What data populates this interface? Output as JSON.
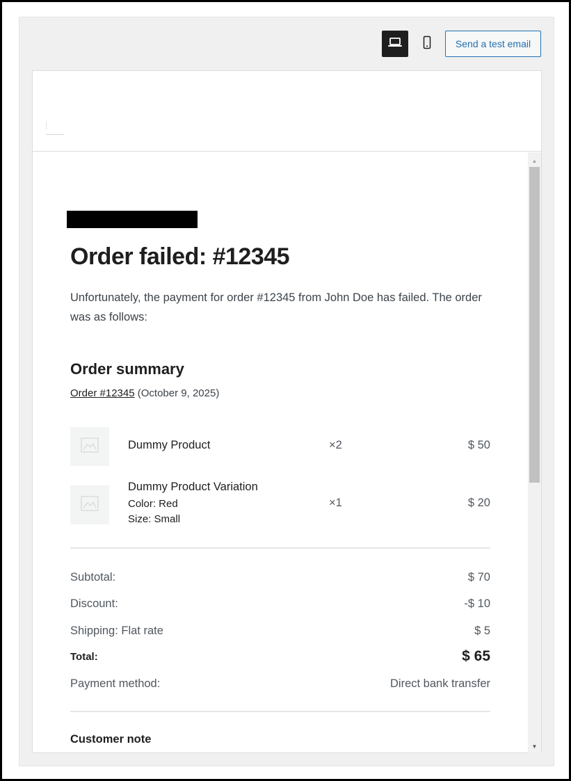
{
  "toolbar": {
    "desktop_icon": "laptop-icon",
    "mobile_icon": "smartphone-icon",
    "send_test_email_label": "Send a test email"
  },
  "email": {
    "title": "Order failed: #12345",
    "intro": "Unfortunately, the payment for order #12345 from John Doe has failed. The order was as follows:",
    "summary_heading": "Order summary",
    "order_link": "Order #12345",
    "order_date": "(October 9, 2025)",
    "items": [
      {
        "name": "Dummy Product",
        "qty": "×2",
        "price": "$ 50",
        "meta": []
      },
      {
        "name": "Dummy Product Variation",
        "qty": "×1",
        "price": "$ 20",
        "meta": [
          "Color: Red",
          "Size: Small"
        ]
      }
    ],
    "totals": {
      "subtotal_label": "Subtotal:",
      "subtotal_value": "$ 70",
      "discount_label": "Discount:",
      "discount_value": "-$ 10",
      "shipping_label": "Shipping: Flat rate",
      "shipping_value": "$ 5",
      "total_label": "Total:",
      "total_value": "$ 65",
      "payment_label": "Payment method:",
      "payment_value": "Direct bank transfer"
    },
    "customer_note_heading": "Customer note"
  },
  "colors": {
    "accent": "#2271b1",
    "active_toggle": "#1e1e1e",
    "panel_background": "#f0f0f1"
  }
}
